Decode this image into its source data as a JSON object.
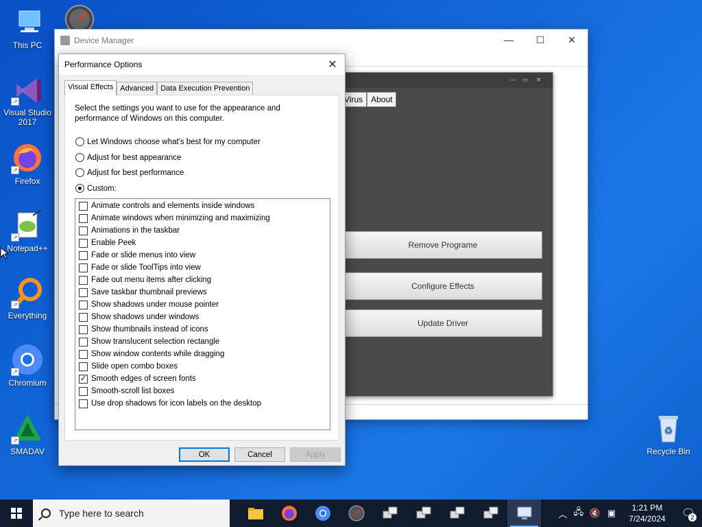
{
  "desktop": {
    "icons": [
      {
        "label": "This PC",
        "icon": "this-pc-icon"
      },
      {
        "label": "Visual Studio 2017",
        "icon": "visual-studio-icon"
      },
      {
        "label": "Firefox",
        "icon": "firefox-icon"
      },
      {
        "label": "Notepad++",
        "icon": "notepadpp-icon"
      },
      {
        "label": "Everything",
        "icon": "everything-icon"
      },
      {
        "label": "Chromium",
        "icon": "chromium-icon"
      },
      {
        "label": "SMADAV",
        "icon": "smadav-icon"
      },
      {
        "label": "Recycle Bin",
        "icon": "recycle-bin-icon"
      }
    ]
  },
  "device_manager": {
    "title": "Device Manager",
    "controls": {
      "minimize": "—",
      "maximize": "☐",
      "close": "✕"
    }
  },
  "dark_tool": {
    "tabs": [
      "Virus",
      "About"
    ],
    "buttons": {
      "remove": "Remove Programe",
      "configure": "Configure Effects",
      "update": "Update Driver"
    }
  },
  "perf_options": {
    "title": "Performance Options",
    "tabs": [
      "Visual Effects",
      "Advanced",
      "Data Execution Prevention"
    ],
    "active_tab": "Visual Effects",
    "description": "Select the settings you want to use for the appearance and performance of Windows on this computer.",
    "radios": [
      {
        "label": "Let Windows choose what's best for my computer",
        "selected": false
      },
      {
        "label": "Adjust for best appearance",
        "selected": false
      },
      {
        "label": "Adjust for best performance",
        "selected": false
      },
      {
        "label": "Custom:",
        "selected": true
      }
    ],
    "checkboxes": [
      {
        "label": "Animate controls and elements inside windows",
        "checked": false
      },
      {
        "label": "Animate windows when minimizing and maximizing",
        "checked": false
      },
      {
        "label": "Animations in the taskbar",
        "checked": false
      },
      {
        "label": "Enable Peek",
        "checked": false
      },
      {
        "label": "Fade or slide menus into view",
        "checked": false
      },
      {
        "label": "Fade or slide ToolTips into view",
        "checked": false
      },
      {
        "label": "Fade out menu items after clicking",
        "checked": false
      },
      {
        "label": "Save taskbar thumbnail previews",
        "checked": false
      },
      {
        "label": "Show shadows under mouse pointer",
        "checked": false
      },
      {
        "label": "Show shadows under windows",
        "checked": false
      },
      {
        "label": "Show thumbnails instead of icons",
        "checked": false
      },
      {
        "label": "Show translucent selection rectangle",
        "checked": false
      },
      {
        "label": "Show window contents while dragging",
        "checked": false
      },
      {
        "label": "Slide open combo boxes",
        "checked": false
      },
      {
        "label": "Smooth edges of screen fonts",
        "checked": true
      },
      {
        "label": "Smooth-scroll list boxes",
        "checked": false
      },
      {
        "label": "Use drop shadows for icon labels on the desktop",
        "checked": false
      }
    ],
    "buttons": {
      "ok": "OK",
      "cancel": "Cancel",
      "apply": "Apply"
    },
    "close_glyph": "✕"
  },
  "taskbar": {
    "search_placeholder": "Type here to search",
    "apps": [
      "file-explorer-icon",
      "firefox-icon",
      "chromium-icon",
      "speedometer-icon",
      "network-app-icon",
      "network-app-icon",
      "network-app-icon",
      "network-app-icon",
      "device-manager-icon"
    ],
    "clock_time": "1:21 PM",
    "clock_date": "7/24/2024",
    "notification_count": "2"
  }
}
